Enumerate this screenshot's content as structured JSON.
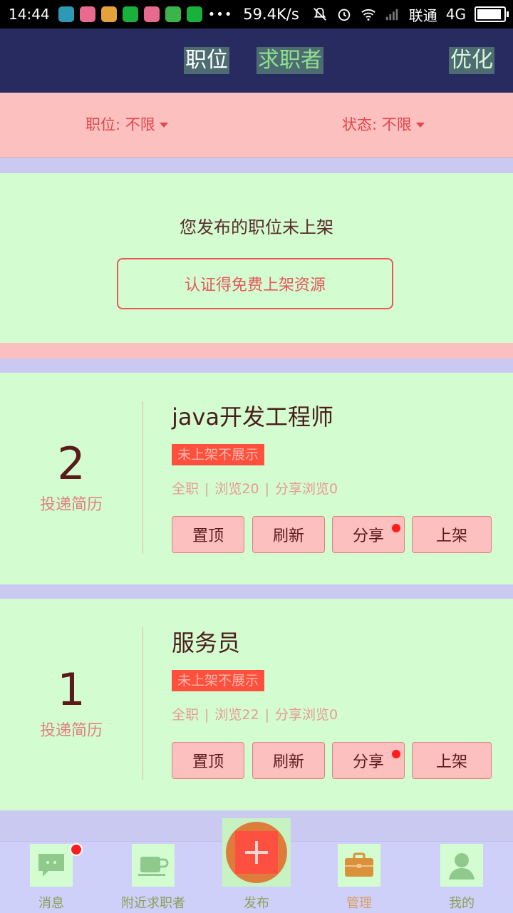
{
  "status_bar": {
    "time": "14:44",
    "dots": "•••",
    "net_speed": "59.4K/s",
    "carrier": "联通",
    "network": "4G",
    "battery_level": 0.92
  },
  "header": {
    "tabs": [
      "职位",
      "求职者"
    ],
    "action": "优化"
  },
  "filters": {
    "position": "职位: 不限",
    "status": "状态: 不限"
  },
  "notice": {
    "text": "您发布的职位未上架",
    "button": "认证得免费上架资源"
  },
  "jobs": [
    {
      "count": "2",
      "count_label": "投递简历",
      "title": "java开发工程师",
      "badge": "未上架不展示",
      "type": "全职",
      "views": "浏览20",
      "share_views": "分享浏览0",
      "actions": [
        "置顶",
        "刷新",
        "分享",
        "上架"
      ]
    },
    {
      "count": "1",
      "count_label": "投递简历",
      "title": "服务员",
      "badge": "未上架不展示",
      "type": "全职",
      "views": "浏览22",
      "share_views": "分享浏览0",
      "actions": [
        "置顶",
        "刷新",
        "分享",
        "上架"
      ]
    }
  ],
  "bottom_nav": {
    "items": [
      {
        "label": "消息",
        "icon": "message-icon"
      },
      {
        "label": "附近求职者",
        "icon": "coffee-cup-icon"
      },
      {
        "label": "发布",
        "icon": "plus-icon"
      },
      {
        "label": "管理",
        "icon": "briefcase-icon"
      },
      {
        "label": "我的",
        "icon": "person-icon"
      }
    ]
  },
  "colors": {
    "header_bg": "#272b60",
    "accent_red": "#fe503d",
    "fab_orange": "#de7d3b"
  }
}
